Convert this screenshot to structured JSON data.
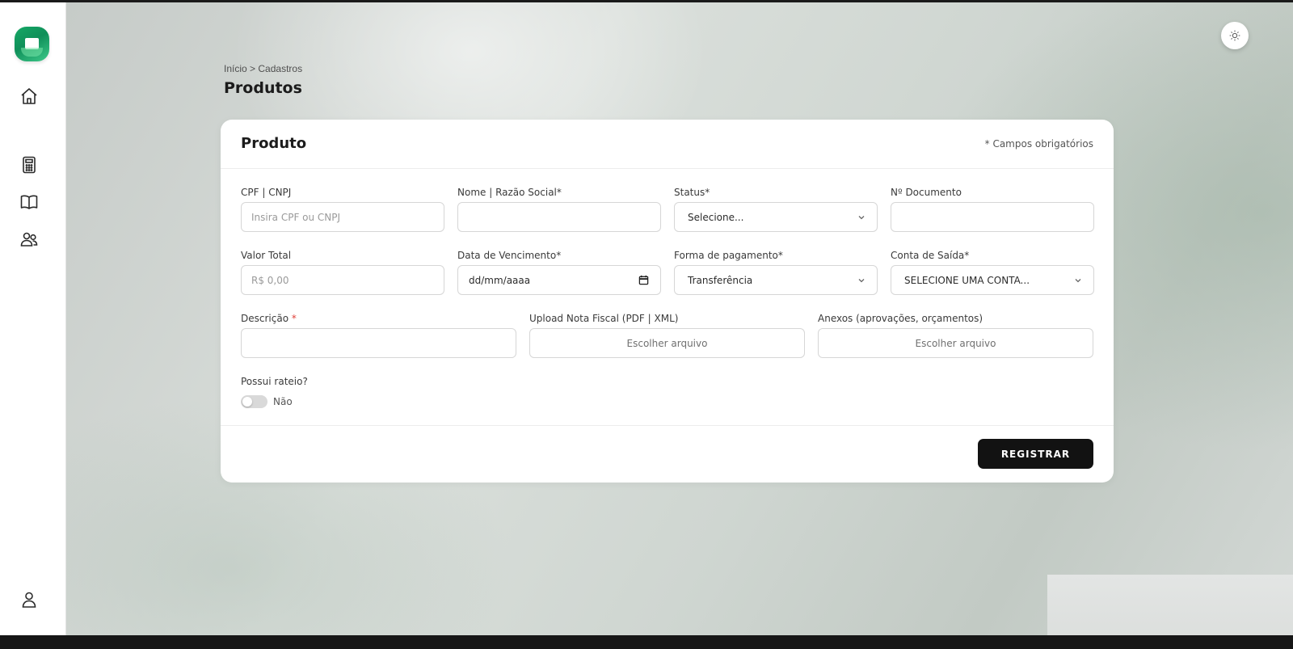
{
  "breadcrumb": {
    "home": "Início",
    "separator": " > ",
    "current": "Cadastros"
  },
  "page_title": "Produtos",
  "card": {
    "title": "Produto",
    "required_note": "* Campos obrigatórios"
  },
  "fields": {
    "cpf": {
      "label": "CPF | CNPJ",
      "placeholder": "Insira CPF ou CNPJ",
      "value": ""
    },
    "nome": {
      "label": "Nome | Razão Social*",
      "placeholder": "",
      "value": ""
    },
    "status": {
      "label": "Status*",
      "selected": "Selecione..."
    },
    "documento": {
      "label": "Nº Documento",
      "placeholder": "",
      "value": ""
    },
    "valor": {
      "label": "Valor Total",
      "placeholder": "R$ 0,00",
      "value": ""
    },
    "vencimento": {
      "label": "Data de Vencimento*",
      "value": "dd/mm/aaaa"
    },
    "pagamento": {
      "label": "Forma de pagamento*",
      "selected": "Transferência"
    },
    "conta": {
      "label": "Conta de Saída*",
      "selected": "SELECIONE UMA CONTA..."
    },
    "descricao": {
      "label": "Descrição",
      "required_mark": "*",
      "placeholder": "",
      "value": ""
    },
    "nota_fiscal": {
      "label": "Upload Nota Fiscal (PDF | XML)",
      "button": "Escolher arquivo"
    },
    "anexos": {
      "label": "Anexos (aprovações, orçamentos)",
      "button": "Escolher arquivo"
    },
    "rateio": {
      "label": "Possui rateio?",
      "toggle_text": "Não",
      "checked": false
    }
  },
  "actions": {
    "register": "REGISTRAR"
  },
  "icons": {
    "logo": "app-logo",
    "nav": [
      "home-icon",
      "calculator-icon",
      "book-icon",
      "users-icon"
    ],
    "bottom": "user-icon",
    "theme": "sun-icon"
  },
  "colors": {
    "brand": "#16a866",
    "primary_button": "#121212",
    "required": "#e0413a"
  }
}
